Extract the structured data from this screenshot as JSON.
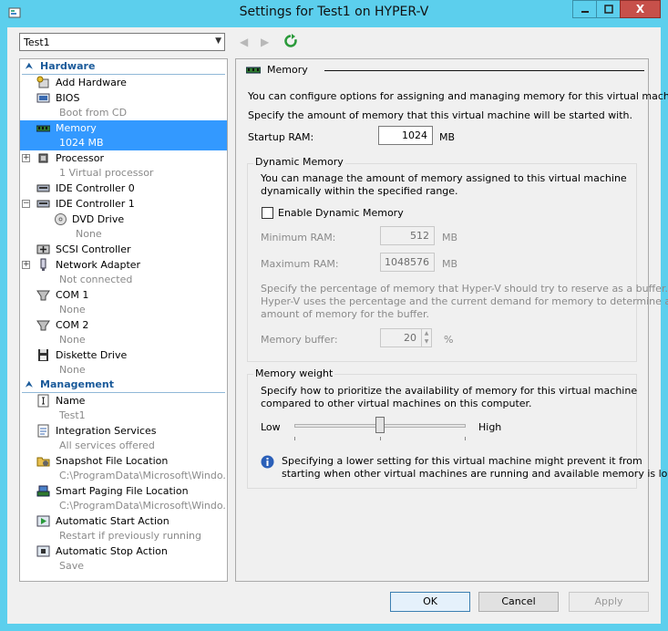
{
  "window": {
    "title": "Settings for Test1 on HYPER-V",
    "minimize": "—",
    "maximize": "□",
    "close": "X"
  },
  "toolbar": {
    "vm_select": "Test1"
  },
  "sidebar": {
    "hardware_header": "Hardware",
    "management_header": "Management",
    "hardware": [
      {
        "label": "Add Hardware",
        "sub": "",
        "icon": "add-hardware-icon"
      },
      {
        "label": "BIOS",
        "sub": "Boot from CD",
        "icon": "bios-icon"
      },
      {
        "label": "Memory",
        "sub": "1024 MB",
        "icon": "memory-icon",
        "selected": true
      },
      {
        "label": "Processor",
        "sub": "1 Virtual processor",
        "icon": "processor-icon"
      },
      {
        "label": "IDE Controller 0",
        "sub": "",
        "icon": "ide-controller-icon"
      },
      {
        "label": "IDE Controller 1",
        "sub": "",
        "icon": "ide-controller-icon"
      },
      {
        "label": "DVD Drive",
        "sub": "None",
        "icon": "dvd-drive-icon"
      },
      {
        "label": "SCSI Controller",
        "sub": "",
        "icon": "scsi-controller-icon"
      },
      {
        "label": "Network Adapter",
        "sub": "Not connected",
        "icon": "network-adapter-icon"
      },
      {
        "label": "COM 1",
        "sub": "None",
        "icon": "com-port-icon"
      },
      {
        "label": "COM 2",
        "sub": "None",
        "icon": "com-port-icon"
      },
      {
        "label": "Diskette Drive",
        "sub": "None",
        "icon": "diskette-drive-icon"
      }
    ],
    "management": [
      {
        "label": "Name",
        "sub": "Test1",
        "icon": "name-icon"
      },
      {
        "label": "Integration Services",
        "sub": "All services offered",
        "icon": "integration-services-icon"
      },
      {
        "label": "Snapshot File Location",
        "sub": "C:\\ProgramData\\Microsoft\\Windo...",
        "icon": "snapshot-folder-icon"
      },
      {
        "label": "Smart Paging File Location",
        "sub": "C:\\ProgramData\\Microsoft\\Windo...",
        "icon": "smart-paging-icon"
      },
      {
        "label": "Automatic Start Action",
        "sub": "Restart if previously running",
        "icon": "auto-start-icon"
      },
      {
        "label": "Automatic Stop Action",
        "sub": "Save",
        "icon": "auto-stop-icon"
      }
    ]
  },
  "memory": {
    "header": "Memory",
    "intro": "You can configure options for assigning and managing memory for this virtual machine.",
    "startup_desc": "Specify the amount of memory that this virtual machine will be started with.",
    "startup_label": "Startup RAM:",
    "startup_value": "1024",
    "unit_mb": "MB",
    "dynamic": {
      "title": "Dynamic Memory",
      "desc1": "You can manage the amount of memory assigned to this virtual machine",
      "desc2": "dynamically within the specified range.",
      "enable_label": "Enable Dynamic Memory",
      "enabled": false,
      "min_label": "Minimum RAM:",
      "min_value": "512",
      "max_label": "Maximum RAM:",
      "max_value": "1048576",
      "buffer_desc1": "Specify the percentage of memory that Hyper-V should try to reserve as a buffer.",
      "buffer_desc2": "Hyper-V uses the percentage and the current demand for memory to determine an",
      "buffer_desc3": "amount of memory for the buffer.",
      "buffer_label": "Memory buffer:",
      "buffer_value": "20",
      "percent": "%"
    },
    "weight": {
      "title": "Memory weight",
      "desc1": "Specify how to prioritize the availability of memory for this virtual machine",
      "desc2": "compared to other virtual machines on this computer.",
      "low": "Low",
      "high": "High",
      "level": 0.5,
      "info1": "Specifying a lower setting for this virtual machine might prevent it from",
      "info2": "starting when other virtual machines are running and available memory is low."
    }
  },
  "buttons": {
    "ok": "OK",
    "cancel": "Cancel",
    "apply": "Apply"
  }
}
